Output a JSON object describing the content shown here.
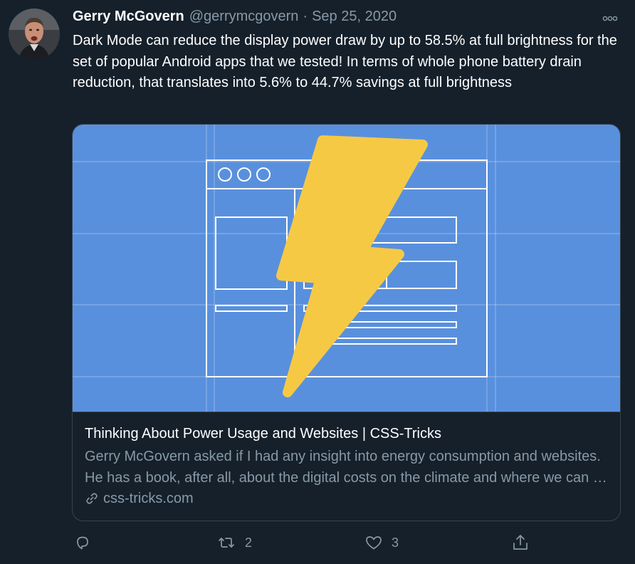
{
  "author": {
    "name": "Gerry McGovern",
    "handle": "@gerrymcgovern",
    "separator": "·",
    "timestamp": "Sep 25, 2020"
  },
  "tweet": {
    "text": "Dark Mode can reduce the display power draw by up to 58.5% at full brightness for the set of popular Android apps that we tested! In terms of whole phone battery drain reduction, that translates into 5.6% to 44.7% savings at full brightness"
  },
  "card": {
    "title": "Thinking About Power Usage and Websites | CSS-Tricks",
    "description": "Gerry McGovern asked if I had any insight into energy consumption and websites. He has a book, after all, about the digital costs on the climate and where we can do better.",
    "domain": "css-tricks.com",
    "image_background": "#5990dd",
    "bolt_color": "#f6c944"
  },
  "actions": {
    "reply_icon": "reply-icon",
    "retweet_icon": "retweet-icon",
    "retweet_count": "2",
    "like_icon": "heart-icon",
    "like_count": "3",
    "share_icon": "share-icon"
  },
  "colors": {
    "background": "#15202b",
    "secondary_text": "#8899a6",
    "border": "#38444d"
  }
}
